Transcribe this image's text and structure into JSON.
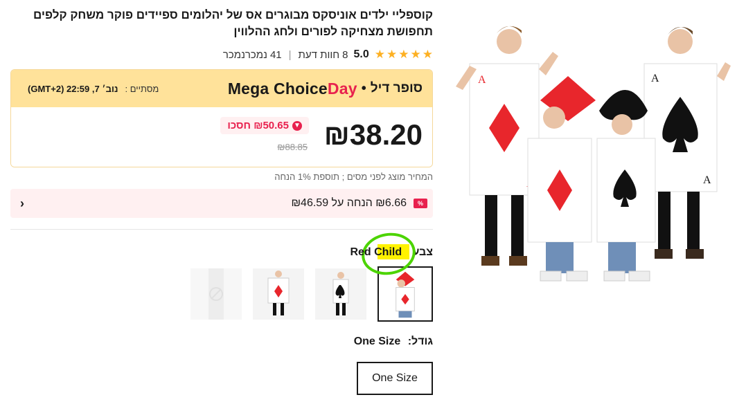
{
  "product": {
    "title": "קוספליי ילדים אוניסקס מבוגרים אס של יהלומים ספיידים פוקר משחק קלפים תחפושת מצחיקה לפורים ולחג ההלווין",
    "rating": "5.0",
    "reviews_count": "8",
    "reviews_label": "חוות דעת",
    "sold_count": "41",
    "sold_label": "נמכרנמכר",
    "separator": "|"
  },
  "deal": {
    "brand_part1": "Mega Choice",
    "brand_part2": "Day",
    "dot": "•",
    "super_label": "סופר דיל",
    "timer_label": "מסתיים :",
    "timer_value": "נוב׳ 7, 22:59 (GMT+2)",
    "price_current": "₪38.20",
    "discount_label": "₪50.65 חסכו",
    "price_original": "₪88.85",
    "colors": {
      "accent_red": "#e8214e",
      "banner_yellow": "#ffe29a"
    }
  },
  "tax_note": "המחיר מוצג לפני מסים ; תוספת 1% הנחה",
  "coupon": {
    "badge": "%",
    "text": "₪6.66 הנחה על ₪46.59",
    "chevron_icon": "chevron-left-icon"
  },
  "color_option": {
    "label": "צבע",
    "value": "Red Child"
  },
  "size_option": {
    "label": "גודל:",
    "value": "One Size",
    "button_label": "One Size"
  }
}
